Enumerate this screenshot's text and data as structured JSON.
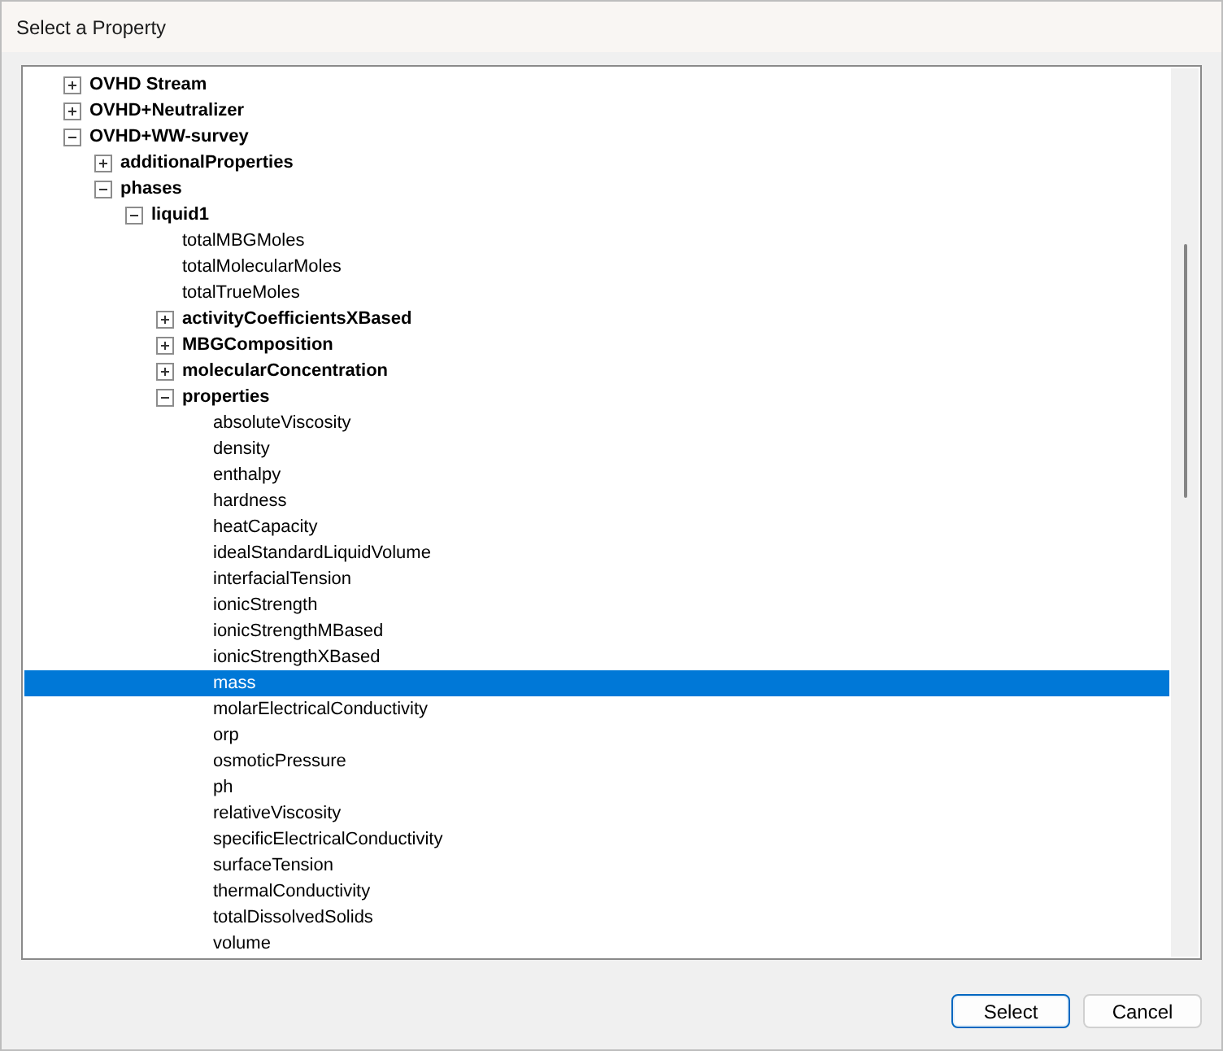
{
  "window": {
    "title": "Select a Property"
  },
  "tree": [
    {
      "label": "OVHD Stream",
      "expanded": false,
      "selected": false
    },
    {
      "label": "OVHD+Neutralizer",
      "expanded": false,
      "selected": false
    },
    {
      "label": "OVHD+WW-survey",
      "expanded": true,
      "selected": false,
      "children": [
        {
          "label": "additionalProperties",
          "expanded": false,
          "selected": false
        },
        {
          "label": "phases",
          "expanded": true,
          "selected": false,
          "children": [
            {
              "label": "liquid1",
              "expanded": true,
              "selected": false,
              "children": [
                {
                  "label": "totalMBGMoles",
                  "selected": false
                },
                {
                  "label": "totalMolecularMoles",
                  "selected": false
                },
                {
                  "label": "totalTrueMoles",
                  "selected": false
                },
                {
                  "label": "activityCoefficientsXBased",
                  "expanded": false,
                  "selected": false
                },
                {
                  "label": "MBGComposition",
                  "expanded": false,
                  "selected": false
                },
                {
                  "label": "molecularConcentration",
                  "expanded": false,
                  "selected": false
                },
                {
                  "label": "properties",
                  "expanded": true,
                  "selected": false,
                  "children": [
                    {
                      "label": "absoluteViscosity",
                      "selected": false
                    },
                    {
                      "label": "density",
                      "selected": false
                    },
                    {
                      "label": "enthalpy",
                      "selected": false
                    },
                    {
                      "label": "hardness",
                      "selected": false
                    },
                    {
                      "label": "heatCapacity",
                      "selected": false
                    },
                    {
                      "label": "idealStandardLiquidVolume",
                      "selected": false
                    },
                    {
                      "label": "interfacialTension",
                      "selected": false
                    },
                    {
                      "label": "ionicStrength",
                      "selected": false
                    },
                    {
                      "label": "ionicStrengthMBased",
                      "selected": false
                    },
                    {
                      "label": "ionicStrengthXBased",
                      "selected": false
                    },
                    {
                      "label": "mass",
                      "selected": true
                    },
                    {
                      "label": "molarElectricalConductivity",
                      "selected": false
                    },
                    {
                      "label": "orp",
                      "selected": false
                    },
                    {
                      "label": "osmoticPressure",
                      "selected": false
                    },
                    {
                      "label": "ph",
                      "selected": false
                    },
                    {
                      "label": "relativeViscosity",
                      "selected": false
                    },
                    {
                      "label": "specificElectricalConductivity",
                      "selected": false
                    },
                    {
                      "label": "surfaceTension",
                      "selected": false
                    },
                    {
                      "label": "thermalConductivity",
                      "selected": false
                    },
                    {
                      "label": "totalDissolvedSolids",
                      "selected": false
                    },
                    {
                      "label": "volume",
                      "selected": false
                    }
                  ]
                }
              ]
            }
          ]
        }
      ]
    }
  ],
  "buttons": [
    {
      "label": "Select",
      "default": true
    },
    {
      "label": "Cancel",
      "default": false
    }
  ]
}
